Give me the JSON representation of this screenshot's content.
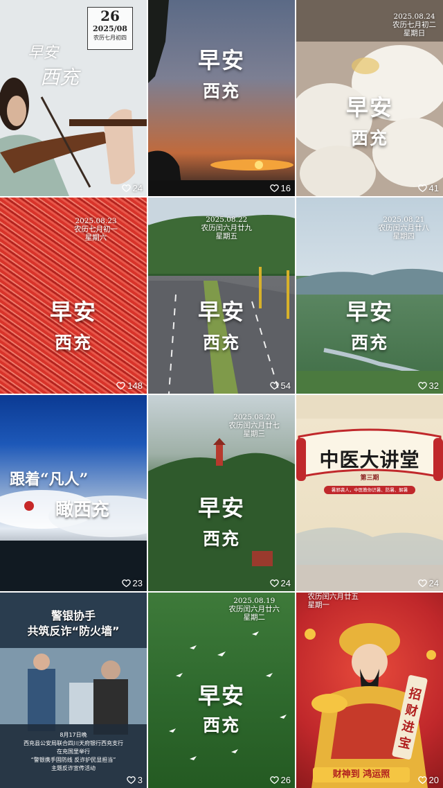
{
  "posts": [
    {
      "likes": "24",
      "date": {
        "day": "26",
        "ym": "2025/08",
        "lunar": "农历七月初四"
      },
      "calligraphy": {
        "l1": "早安",
        "l2": "西充"
      }
    },
    {
      "likes": "16",
      "title": {
        "l1": "早安",
        "l2": "西充"
      }
    },
    {
      "likes": "41",
      "title": {
        "l1": "早安",
        "l2": "西充"
      },
      "date": {
        "d": "2025.08.24",
        "lunar": "农历七月初二",
        "week": "星期日"
      }
    },
    {
      "likes": "148",
      "title": {
        "l1": "早安",
        "l2": "西充"
      },
      "date": {
        "d": "2025.08.23",
        "lunar": "农历七月初一",
        "week": "星期六"
      }
    },
    {
      "likes": "54",
      "title": {
        "l1": "早安",
        "l2": "西充"
      },
      "date": {
        "d": "2025.08.22",
        "lunar": "农历闰六月廿九",
        "week": "星期五"
      }
    },
    {
      "likes": "32",
      "title": {
        "l1": "早安",
        "l2": "西充"
      },
      "date": {
        "d": "2025.08.21",
        "lunar": "农历闰六月廿八",
        "week": "星期四"
      }
    },
    {
      "likes": "23",
      "title": {
        "l1": "跟着“凡人”",
        "l2": "瞰西充"
      }
    },
    {
      "likes": "24",
      "title": {
        "l1": "早安",
        "l2": "西充"
      },
      "date": {
        "d": "2025.08.20",
        "lunar": "农历闰六月廿七",
        "week": "星期三"
      }
    },
    {
      "likes": "24",
      "banner": {
        "title": "中医大讲堂",
        "issue": "第三期",
        "sub": "暑邪袭人，中医教你识暑、防暑、解暑"
      }
    },
    {
      "likes": "3",
      "headline": {
        "l1": "警银协手",
        "l2": "共筑反诈“防火墙”"
      },
      "caption": [
        "8月17日晚",
        "西充县公安局联合四川天府银行西充支行",
        "在充国里举行",
        "“警银携手固防线 反诈护民显担当”",
        "主题反诈宣传活动"
      ]
    },
    {
      "likes": "26",
      "title": {
        "l1": "早安",
        "l2": "西充"
      },
      "date": {
        "d": "2025.08.19",
        "lunar": "农历闰六月廿六",
        "week": "星期二"
      }
    },
    {
      "likes": "20",
      "date": {
        "lunar": "农历闰六月廿五",
        "week": "星期一"
      },
      "scroll": "招财进宝",
      "footer": "财神到 鸿运照"
    }
  ],
  "colors": {
    "heart": "#ffffff",
    "badge_red": "#c0282b",
    "gold": "#e8b33a"
  }
}
